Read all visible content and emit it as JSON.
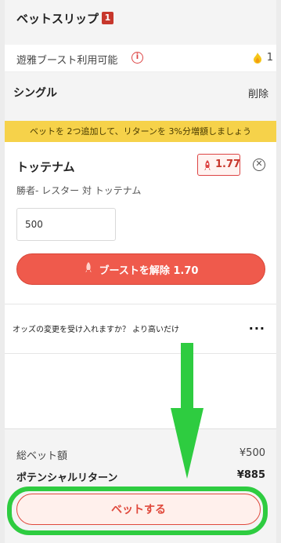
{
  "header": {
    "title": "ベットスリップ",
    "badge": "1"
  },
  "boost": {
    "label": "遊雅ブースト利用可能",
    "count": "1",
    "info_icon": "info-icon",
    "boost_icon": "flame-icon"
  },
  "single": {
    "label": "シングル",
    "delete": "削除"
  },
  "promo": {
    "text": "ベットを 2つ追加して、リターンを 3%分増額しましょう"
  },
  "selection": {
    "team": "トッテナム",
    "odds": "1.77",
    "market": "勝者- レスター 対 トッテナム",
    "stake_value": "500",
    "unboost_label": "ブーストを解除 1.70"
  },
  "odds_change": {
    "text": "オッズの変更を受け入れますか？ より高いだけ",
    "more": "..."
  },
  "summary": {
    "total_label": "総ベット額",
    "total_value": "¥500",
    "return_label": "ポテンシャルリターン",
    "return_value": "¥885",
    "bet_button": "ベットする"
  },
  "colors": {
    "accent": "#ef5a4c",
    "promo": "#f6d24a",
    "annotation": "#2ecc40"
  }
}
